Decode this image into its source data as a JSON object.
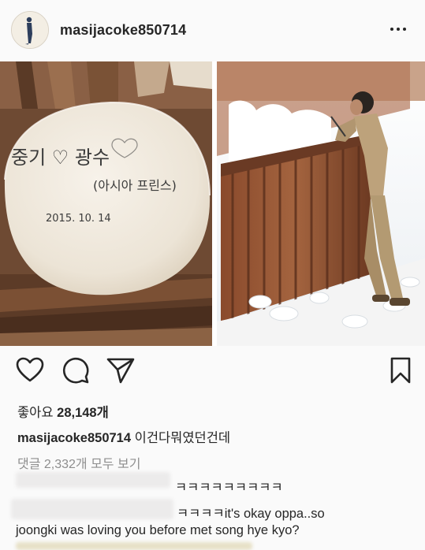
{
  "post": {
    "username": "masijacoke850714",
    "likes_label": "좋아요",
    "likes_count": "28,148개",
    "caption_text": "이건다뭐였던건데",
    "view_comments": "댓글 2,332개 모두 보기"
  },
  "stone_text": {
    "line1": "중기 ♡ 광수",
    "line2": "(아시아 프린스)",
    "date": "2015. 10. 14"
  },
  "comments": [
    {
      "text": "ㅋㅋㅋㅋㅋㅋㅋㅋㅋ"
    },
    {
      "text": "ㅋㅋㅋㅋit's okay oppa..so",
      "continuation": "joongki was loving you before met song hye kyo?"
    }
  ],
  "icons": [
    "more-icon",
    "heart-icon",
    "comment-icon",
    "share-icon",
    "bookmark-icon"
  ]
}
